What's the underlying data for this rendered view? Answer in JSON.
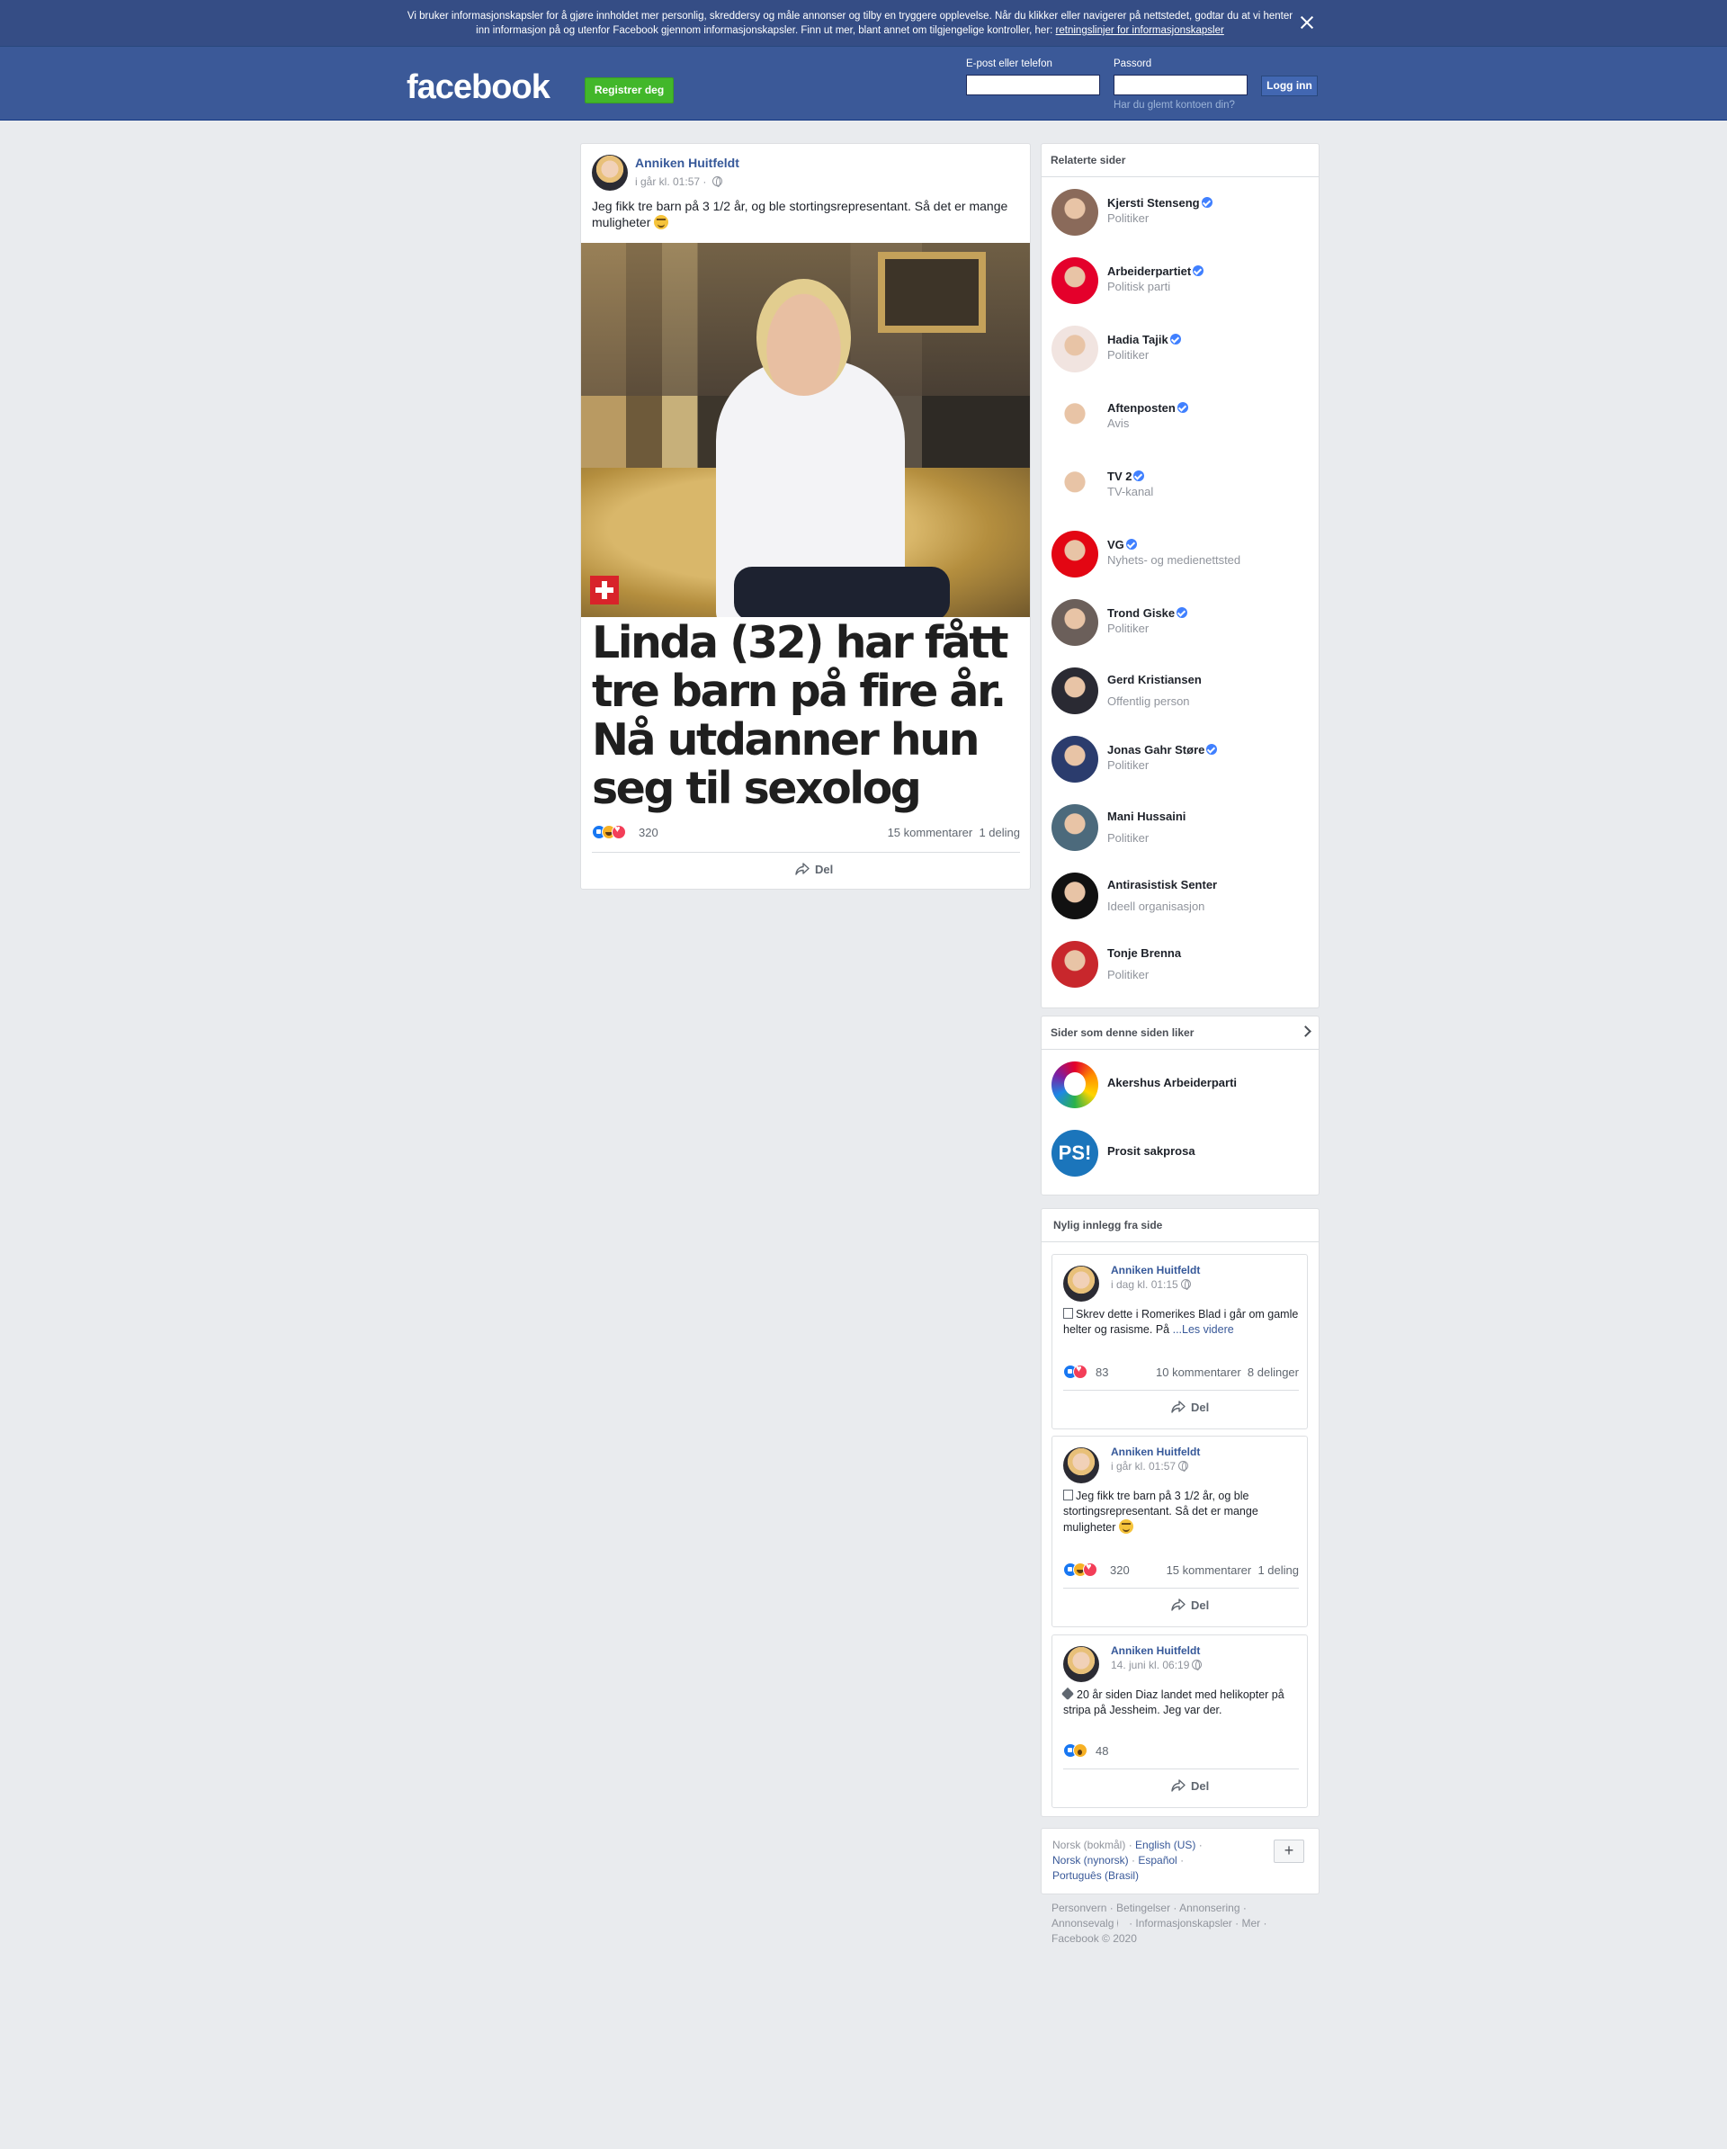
{
  "cookie_banner": {
    "text": "Vi bruker informasjonskapsler for å gjøre innholdet mer personlig, skreddersy og måle annonser og tilby en tryggere opplevelse. Når du klikker eller navigerer på nettstedet, godtar du at vi henter inn informasjon på og utenfor Facebook gjennom informasjonskapsler. Finn ut mer, blant annet om tilgjengelige kontroller, her: ",
    "link": "retningslinjer for informasjonskapsler",
    "close_icon": "close-icon"
  },
  "header": {
    "logo": "facebook",
    "register_label": "Registrer deg",
    "email_label": "E-post eller telefon",
    "password_label": "Passord",
    "login_label": "Logg inn",
    "forgot_label": "Har du glemt kontoen din?"
  },
  "post": {
    "author": "Anniken Huitfeldt",
    "time": "i går kl. 01:57 · ",
    "text": "Jeg fikk tre barn på 3 1/2 år, og ble stortingsrepresentant. Så det er mange muligheter ",
    "headline": "Linda (32) har fått tre barn på fire år. Nå utdanner hun seg til sexolog",
    "reaction_count": "320",
    "comments": "15 kommentarer",
    "shares": "1 deling",
    "share_label": "Del"
  },
  "related": {
    "title": "Relaterte sider",
    "pages": [
      {
        "name": "Kjersti Stenseng",
        "category": "Politiker",
        "verified": true,
        "color": "#8a6a5a"
      },
      {
        "name": "Arbeiderpartiet",
        "category": "Politisk parti",
        "verified": true,
        "color": "#e4002b"
      },
      {
        "name": "Hadia Tajik",
        "category": "Politiker",
        "verified": true,
        "color": "#f1e4e0"
      },
      {
        "name": "Aftenposten",
        "category": "Avis",
        "verified": true,
        "color": "#ffffff"
      },
      {
        "name": "TV 2",
        "category": "TV-kanal",
        "verified": true,
        "color": "#ffffff"
      },
      {
        "name": "VG",
        "category": "Nyhets- og medienettsted",
        "verified": true,
        "color": "#e30613"
      },
      {
        "name": "Trond Giske",
        "category": "Politiker",
        "verified": true,
        "color": "#6b5f5a"
      },
      {
        "name": "Gerd Kristiansen",
        "category": "Offentlig person",
        "verified": false,
        "color": "#2a2a33"
      },
      {
        "name": "Jonas Gahr Støre",
        "category": "Politiker",
        "verified": true,
        "color": "#2b3c6d"
      },
      {
        "name": "Mani Hussaini",
        "category": "Politiker",
        "verified": false,
        "color": "#4c6a7c"
      },
      {
        "name": "Antirasistisk Senter",
        "category": "Ideell organisasjon",
        "verified": false,
        "color": "#111111"
      },
      {
        "name": "Tonje Brenna",
        "category": "Politiker",
        "verified": false,
        "color": "#c8272c"
      }
    ]
  },
  "liked": {
    "title": "Sider som denne siden liker",
    "pages": [
      {
        "name": "Akershus Arbeiderparti"
      },
      {
        "name": "Prosit sakprosa"
      }
    ]
  },
  "recent": {
    "title": "Nylig innlegg fra side",
    "posts": [
      {
        "author": "Anniken Huitfeldt",
        "time": "i dag kl. 01:15",
        "text": "Skrev dette i Romerikes Blad i går om gamle helter og rasisme. På ",
        "more": "...Les videre",
        "count": "83",
        "comments": "10 kommentarer",
        "shares": "8 delinger",
        "share": "Del"
      },
      {
        "author": "Anniken Huitfeldt",
        "time": "i går kl. 01:57",
        "text": "Jeg fikk tre barn på 3 1/2 år, og ble stortingsrepresentant. Så det er mange muligheter ",
        "count": "320",
        "comments": "15 kommentarer",
        "shares": "1 deling",
        "share": "Del"
      },
      {
        "author": "Anniken Huitfeldt",
        "time": "14. juni kl. 06:19",
        "text": "20 år siden Diaz landet med helikopter på stripa på Jessheim. Jeg var der.",
        "count": "48",
        "share": "Del"
      }
    ]
  },
  "languages": {
    "current": "Norsk (bokmål)",
    "options": [
      "English (US)",
      "Norsk (nynorsk)",
      "Español",
      "Português (Brasil)"
    ],
    "plus": "+"
  },
  "footer": {
    "links": [
      "Personvern",
      "Betingelser",
      "Annonsering",
      "Annonsevalg",
      "Informasjonskapsler",
      "Mer"
    ],
    "copyright": "Facebook © 2020"
  }
}
